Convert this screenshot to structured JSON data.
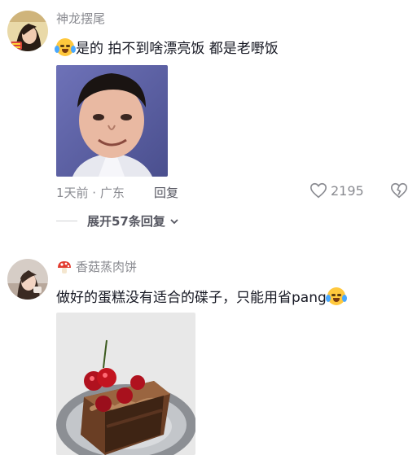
{
  "comments": [
    {
      "username": "神龙摆尾",
      "text": "是的 拍不到啥漂亮饭 都是老嘢饭",
      "time_location": "1天前 · 广东",
      "reply_label": "回复",
      "like_count": "2195",
      "expand_label": "展开57条回复",
      "leading_emoji": "crying-laughing-emoji",
      "photo": "photo-of-young-man-face"
    },
    {
      "username": "香菇蒸肉饼",
      "username_badge": "mushroom-icon",
      "text": "做好的蛋糕没有适合的碟子，只能用省pang",
      "trailing_emoji": "crying-laughing-emoji",
      "photo": "photo-of-chocolate-cherry-cake-on-plate"
    }
  ],
  "colors": {
    "primary_text": "#161823",
    "secondary_text": "#8a8b91",
    "expand_text": "#555660",
    "emoji": "#ffc83d"
  }
}
